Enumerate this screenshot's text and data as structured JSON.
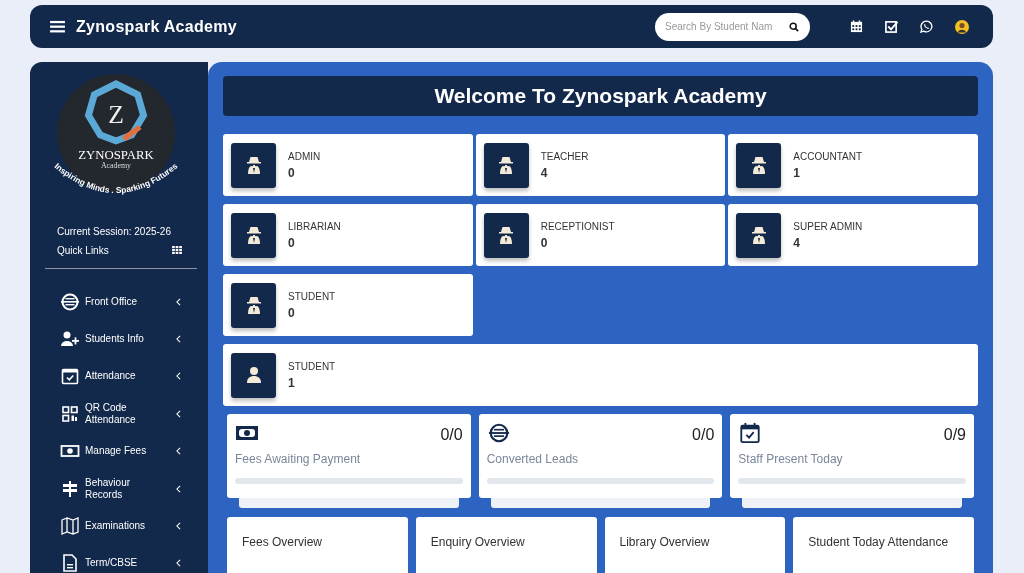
{
  "topbar": {
    "title": "Zynospark Academy",
    "search": {
      "placeholder": "Search By Student Nam"
    }
  },
  "sidebar": {
    "logo": {
      "letter": "Z",
      "name": "ZYNOSPARK",
      "subtitle": "Academy",
      "tagline": "Inspiring Minds . Sparking Futures"
    },
    "session": "Current Session: 2025-26",
    "quick_links": "Quick Links",
    "items": [
      {
        "label": "Front Office"
      },
      {
        "label": "Students Info"
      },
      {
        "label": "Attendance"
      },
      {
        "label": "QR Code Attendance"
      },
      {
        "label": "Manage Fees"
      },
      {
        "label": "Behaviour Records"
      },
      {
        "label": "Examinations"
      },
      {
        "label": "Term/CBSE"
      }
    ]
  },
  "welcome": "Welcome To Zynospark Academy",
  "roles": [
    {
      "label": "ADMIN",
      "count": "0"
    },
    {
      "label": "TEACHER",
      "count": "4"
    },
    {
      "label": "ACCOUNTANT",
      "count": "1"
    },
    {
      "label": "LIBRARIAN",
      "count": "0"
    },
    {
      "label": "RECEPTIONIST",
      "count": "0"
    },
    {
      "label": "SUPER ADMIN",
      "count": "4"
    },
    {
      "label": "STUDENT",
      "count": "0"
    }
  ],
  "student_total": {
    "label": "STUDENT",
    "count": "1"
  },
  "stats": [
    {
      "value": "0/0",
      "label": "Fees Awaiting Payment",
      "level": 0
    },
    {
      "value": "0/0",
      "label": "Converted Leads",
      "level": 0
    },
    {
      "value": "0/9",
      "label": "Staff Present Today",
      "level": 0
    }
  ],
  "overviews": [
    "Fees Overview",
    "Enquiry Overview",
    "Library Overview",
    "Student Today Attendance"
  ]
}
